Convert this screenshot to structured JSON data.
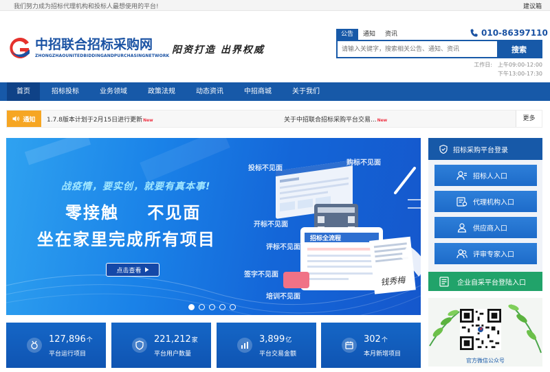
{
  "topbar": {
    "slogan": "我们努力成为招标代理机构和投标人最想使用的平台!",
    "mailbox": "建议箱"
  },
  "logo": {
    "name_cn": "中招联合招标采购网",
    "name_en": "ZHONGZHAOUNITEDBIDDINGANDPURCHASINGNETWORK"
  },
  "motto": "阳资打造 出界权威",
  "search": {
    "tabs": [
      "公告",
      "通知",
      "资讯"
    ],
    "placeholder": "请输入关键字，搜索相关公告、通知、资讯",
    "button": "搜索"
  },
  "contact": {
    "phone": "010-86397110",
    "worktime_label": "工作日:",
    "am": "上午09:00-12:00",
    "pm": "下午13:00-17:30"
  },
  "nav": [
    "首页",
    "招标投标",
    "业务领域",
    "政策法规",
    "动态资讯",
    "中招商城",
    "关于我们"
  ],
  "notice": {
    "tag": "通知",
    "items": [
      "1.7.8版本计划于2月15日进行更新",
      "关于中招联合招标采购平台交易..."
    ],
    "new_badge": "New",
    "more": "更多"
  },
  "banner": {
    "subtitle": "战疫情，要实创，就要有真本事!",
    "line1": "零接触    不见面",
    "line2": "坐在家里完成所有项目",
    "button": "点击查看",
    "labels": [
      "投标不见面",
      "购标不见面",
      "开标不见面",
      "评标不见面",
      "签字不见面",
      "培训不见面"
    ],
    "screen_title": "招标全流程",
    "signature": "钱秀梅",
    "slide_count": 5,
    "active_slide": 0
  },
  "sidebar": {
    "title": "招标采购平台登录",
    "entries": [
      "招标人入口",
      "代理机构入口",
      "供应商入口",
      "评审专家入口"
    ],
    "self_service": "企业自采平台登陆入口",
    "wechat_caption": "官方微信公众号"
  },
  "stats": [
    {
      "value": "127,896",
      "unit": "个",
      "label": "平台运行项目"
    },
    {
      "value": "221,212",
      "unit": "家",
      "label": "平台用户数量"
    },
    {
      "value": "3,899",
      "unit": "亿",
      "label": "平台交易金额"
    },
    {
      "value": "302",
      "unit": "个",
      "label": "本月新增项目"
    }
  ],
  "colors": {
    "primary": "#1759a8",
    "nav_active": "#0f4287",
    "notice_tag": "#f6a623",
    "self_service": "#21a36a",
    "logo_red": "#e5322d"
  }
}
